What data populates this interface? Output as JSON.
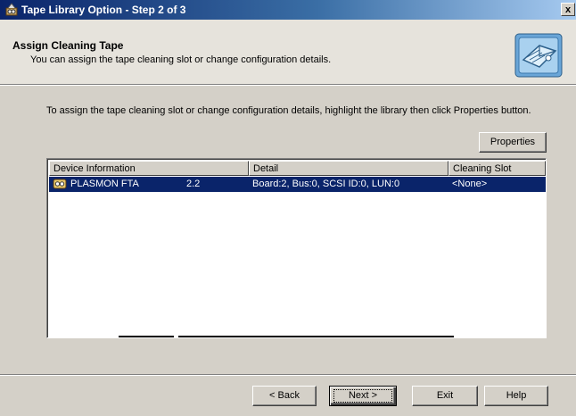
{
  "window": {
    "title": "Tape Library Option - Step 2 of 3",
    "close_label": "x"
  },
  "header": {
    "title": "Assign Cleaning Tape",
    "subtitle": "You can assign the tape cleaning slot or change configuration details."
  },
  "body": {
    "instructions": "To assign the tape cleaning slot or change configuration details, highlight the library then click Properties button.",
    "properties_button": "Properties"
  },
  "list": {
    "columns": [
      "Device Information",
      "Detail",
      "Cleaning Slot"
    ],
    "rows": [
      {
        "name": "PLASMON FTA",
        "version": "2.2",
        "detail": "Board:2, Bus:0, SCSI ID:0, LUN:0",
        "cleaning_slot": "<None>",
        "selected": true
      }
    ]
  },
  "footer": {
    "back_button": "< Back",
    "next_button": "Next >",
    "exit_button": "Exit",
    "help_button": "Help"
  },
  "colors": {
    "selection": "#0a246a",
    "window_face": "#d4d0c8",
    "title_bar": "#0a246a"
  },
  "icons": {
    "app": "tape-library-icon",
    "wizard": "tape-cartridge-icon",
    "device": "tape-drive-icon"
  }
}
